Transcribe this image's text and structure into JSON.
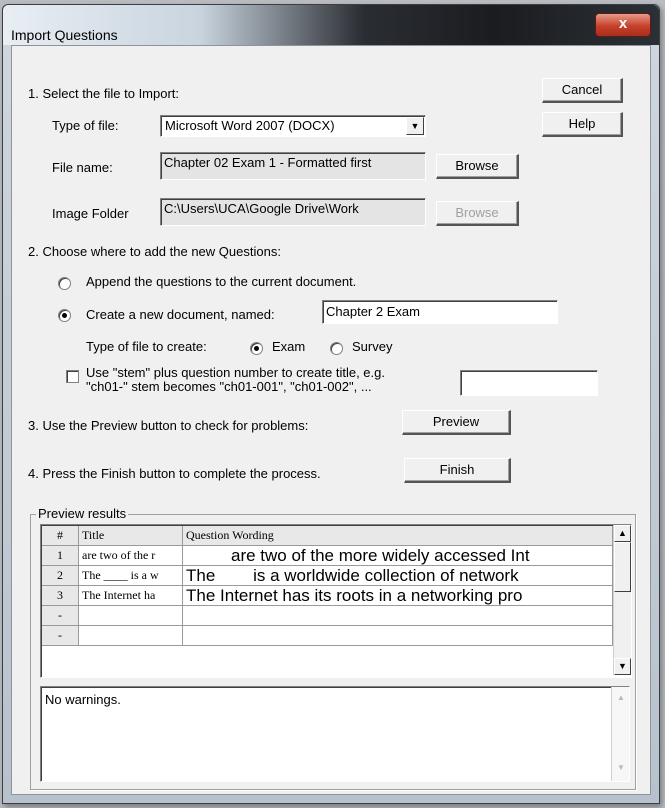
{
  "window": {
    "title": "Import Questions",
    "close_glyph": "x"
  },
  "buttons": {
    "cancel": "Cancel",
    "help": "Help",
    "browse_file": "Browse",
    "browse_image": "Browse",
    "preview": "Preview",
    "finish": "Finish"
  },
  "step1": {
    "heading": "1.  Select the file to Import:",
    "type_label": "Type of file:",
    "type_value": "Microsoft Word 2007 (DOCX)",
    "file_label": "File name:",
    "file_value": "Chapter 02 Exam 1 - Formatted first",
    "image_label": "Image Folder",
    "image_value": "C:\\Users\\UCA\\Google Drive\\Work"
  },
  "step2": {
    "heading": "2.  Choose where to add the new Questions:",
    "append_label": "Append the questions to the current document.",
    "create_label": "Create a new document, named:",
    "create_name": "Chapter 2 Exam",
    "type_create_label": "Type of file to create:",
    "exam_label": "Exam",
    "survey_label": "Survey",
    "stem_label_line1": "Use \"stem\" plus question number to create title,  e.g.",
    "stem_label_line2": "\"ch01-\" stem becomes \"ch01-001\",  \"ch01-002\",  ...",
    "stem_value": ""
  },
  "step3": {
    "text": "3.  Use the Preview button to check for problems:"
  },
  "step4": {
    "text": "4.  Press the Finish button to complete the process."
  },
  "preview": {
    "group_label": "Preview results",
    "columns": [
      "#",
      "Title",
      "Question Wording"
    ],
    "rows": [
      {
        "num": "1",
        "title": "are two of the r",
        "wording": "are two of the more widely accessed Int"
      },
      {
        "num": "2",
        "title": "The ____ is a w",
        "wording": "The        is a worldwide collection of network"
      },
      {
        "num": "3",
        "title": "The Internet ha",
        "wording": "The Internet has its roots in a networking pro"
      },
      {
        "num": "-",
        "title": "",
        "wording": ""
      },
      {
        "num": "-",
        "title": "",
        "wording": ""
      }
    ]
  },
  "warnings": {
    "text": "No warnings."
  }
}
